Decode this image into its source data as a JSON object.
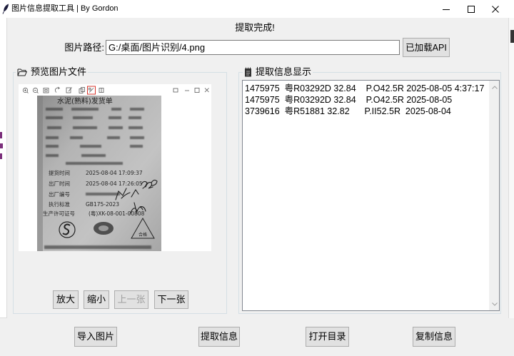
{
  "window": {
    "title": "图片信息提取工具 | By Gordon",
    "app_icon": "feather-icon",
    "controls": {
      "minimize": "minimize-icon",
      "maximize": "maximize-icon",
      "close": "close-icon"
    }
  },
  "status": "提取完成!",
  "path": {
    "label": "图片路径:",
    "value": "G:/桌面/图片识别/4.png",
    "api_button": "已加载API"
  },
  "preview": {
    "title": "预览图片文件",
    "icon": "folder-icon",
    "photo": {
      "heading": "水泥(熟料)发货单",
      "rows": [
        {
          "label": "提货时间",
          "value": "2025-08-04 17:09:37"
        },
        {
          "label": "出厂时间",
          "value": "2025-08-04 17:26:05"
        },
        {
          "label": "出厂编号"
        },
        {
          "label": "执行标准",
          "value": "GB175-2023"
        },
        {
          "label": "生产许可证号",
          "value": "(粤)XK-08-001-00808"
        }
      ],
      "seal": "合格"
    },
    "buttons": {
      "zoom_in": "放大",
      "zoom_out": "缩小",
      "prev": "上一张",
      "next": "下一张"
    },
    "prev_enabled": false
  },
  "results": {
    "title": "提取信息显示",
    "icon": "notepad-icon",
    "lines": [
      "1475975  粤R03292D 32.84    P.O42.5R 2025-08-05 4:37:17",
      "1475975  粤R03292D 32.84    P.O42.5R 2025-08-05",
      "3739616  粤R51881 32.82      P.II52.5R  2025-08-04"
    ]
  },
  "actions": {
    "import_image": "导入图片",
    "extract_info": "提取信息",
    "open_folder": "打开目录",
    "copy_info": "复制信息"
  },
  "colors": {
    "window_bg": "#f0f0f0",
    "button_bg": "#e1e1e1",
    "button_border": "#adadad",
    "disabled_text": "#a0a0a0",
    "highlight": "#d9342b"
  }
}
